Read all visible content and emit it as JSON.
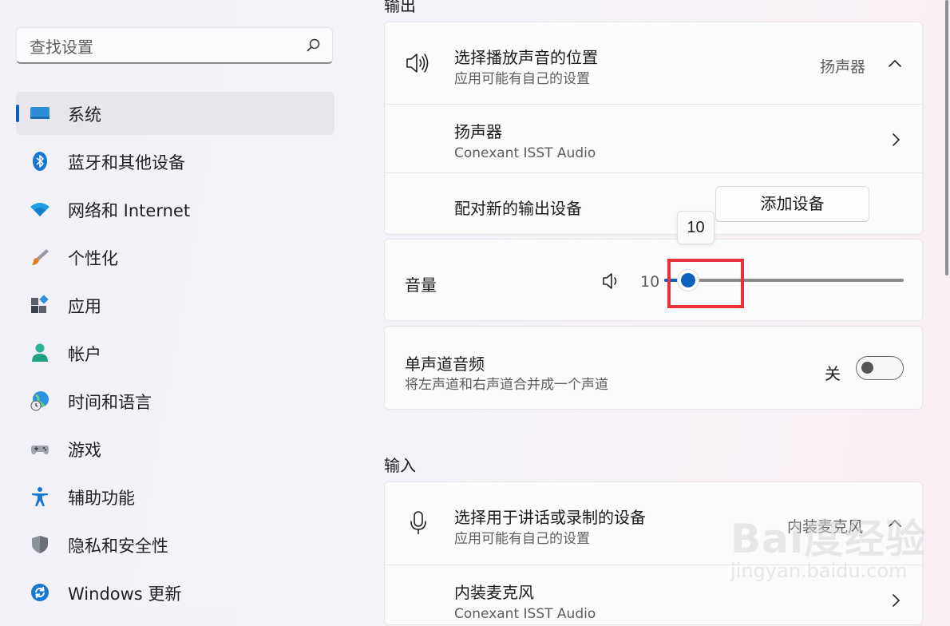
{
  "search": {
    "placeholder": "查找设置"
  },
  "nav": [
    {
      "label": "系统",
      "icon": "monitor-icon",
      "selected": true
    },
    {
      "label": "蓝牙和其他设备",
      "icon": "bluetooth-icon"
    },
    {
      "label": "网络和 Internet",
      "icon": "wifi-icon"
    },
    {
      "label": "个性化",
      "icon": "brush-icon"
    },
    {
      "label": "应用",
      "icon": "apps-icon"
    },
    {
      "label": "帐户",
      "icon": "person-icon"
    },
    {
      "label": "时间和语言",
      "icon": "globe-clock-icon"
    },
    {
      "label": "游戏",
      "icon": "gamepad-icon"
    },
    {
      "label": "辅助功能",
      "icon": "accessibility-icon"
    },
    {
      "label": "隐私和安全性",
      "icon": "shield-icon"
    },
    {
      "label": "Windows 更新",
      "icon": "update-icon"
    }
  ],
  "output": {
    "section_title": "输出",
    "choose_title": "选择播放声音的位置",
    "choose_subtitle": "应用可能有自己的设置",
    "choose_value": "扬声器",
    "device_name": "扬声器",
    "device_driver": "Conexant ISST Audio",
    "pair_label": "配对新的输出设备",
    "add_button": "添加设备"
  },
  "volume": {
    "label": "音量",
    "value": "10",
    "tooltip": "10",
    "level_percent": 10
  },
  "mono": {
    "title": "单声道音频",
    "subtitle": "将左声道和右声道合并成一个声道",
    "state_label": "关",
    "on": false
  },
  "input": {
    "section_title": "输入",
    "choose_title": "选择用于讲话或录制的设备",
    "choose_subtitle": "应用可能有自己的设置",
    "choose_value": "内装麦克风",
    "device_name": "内装麦克风",
    "device_driver": "Conexant ISST Audio"
  },
  "watermark": {
    "logo": "Bai度经验",
    "url": "jingyan.baidu.com"
  },
  "colors": {
    "accent": "#0a5fbf",
    "highlight": "#e8303a",
    "slider_track": "#8a8a8a"
  }
}
